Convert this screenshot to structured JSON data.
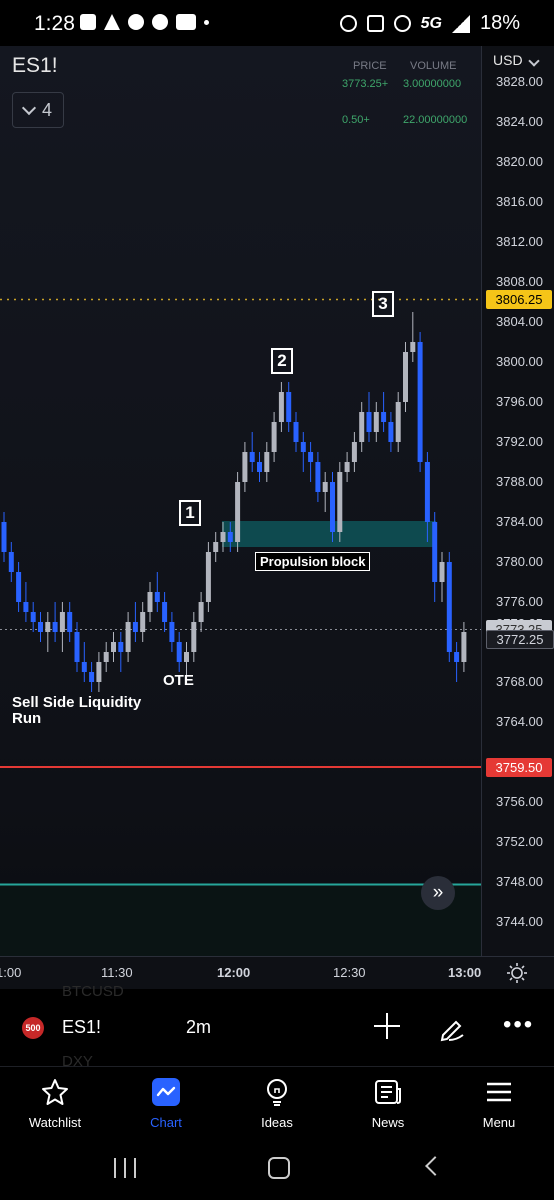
{
  "status_bar": {
    "time": "1:28",
    "network": "5G",
    "battery": "18%",
    "icons": [
      "chat-icon",
      "alert-icon",
      "messenger-icon",
      "spotify-icon",
      "news-icon",
      "dot-icon",
      "alarm-icon",
      "mute-icon",
      "hotspot-icon",
      "signal-icon",
      "battery-icon"
    ]
  },
  "chart": {
    "symbol": "ES1!",
    "counter": "4",
    "currency": "USD",
    "price_header": "PRICE",
    "volume_header": "VOLUME",
    "rows": [
      {
        "price": "3773.25+",
        "volume": "3.00000000"
      },
      {
        "price": "0.50+",
        "volume": "22.00000000"
      }
    ],
    "price_axis": [
      "3828.00",
      "3824.00",
      "3820.00",
      "3816.00",
      "3812.00",
      "3808.00",
      "3804.00",
      "3800.00",
      "3796.00",
      "3792.00",
      "3788.00",
      "3784.00",
      "3780.00",
      "3776.00",
      "3772.25",
      "3768.00",
      "3764.00",
      "3756.00",
      "3752.00",
      "3748.00",
      "3744.00"
    ],
    "tags": {
      "high_line": "3806.25",
      "current_hidden": "3773.25",
      "current": "3772.25",
      "low_line": "3759.50"
    },
    "time_axis": [
      "1:00",
      "11:30",
      "12:00",
      "12:30",
      "13:00"
    ],
    "annotations": {
      "marker_1": "1",
      "marker_2": "2",
      "marker_3": "3",
      "propulsion": "Propulsion block",
      "ote": "OTE",
      "sell_side": "Sell Side Liquidity Run"
    },
    "colors": {
      "bull": "#b2b5be",
      "bear": "#2962ff",
      "high_line": "#c9a227",
      "low_line": "#e53935",
      "teal_line": "#26a69a",
      "zone": "#0e4a4f"
    },
    "scroll_icon": "double-chevron-right-icon",
    "settings_icon": "sun-icon"
  },
  "toolbar": {
    "ghost_top": "BTCUSD",
    "ghost_bottom": "DXY",
    "badge": "500",
    "symbol": "ES1!",
    "interval": "2m"
  },
  "nav": [
    {
      "label": "Watchlist",
      "icon": "star-icon"
    },
    {
      "label": "Chart",
      "icon": "chart-icon"
    },
    {
      "label": "Ideas",
      "icon": "lightbulb-icon"
    },
    {
      "label": "News",
      "icon": "news-icon"
    },
    {
      "label": "Menu",
      "icon": "hamburger-icon"
    }
  ]
}
